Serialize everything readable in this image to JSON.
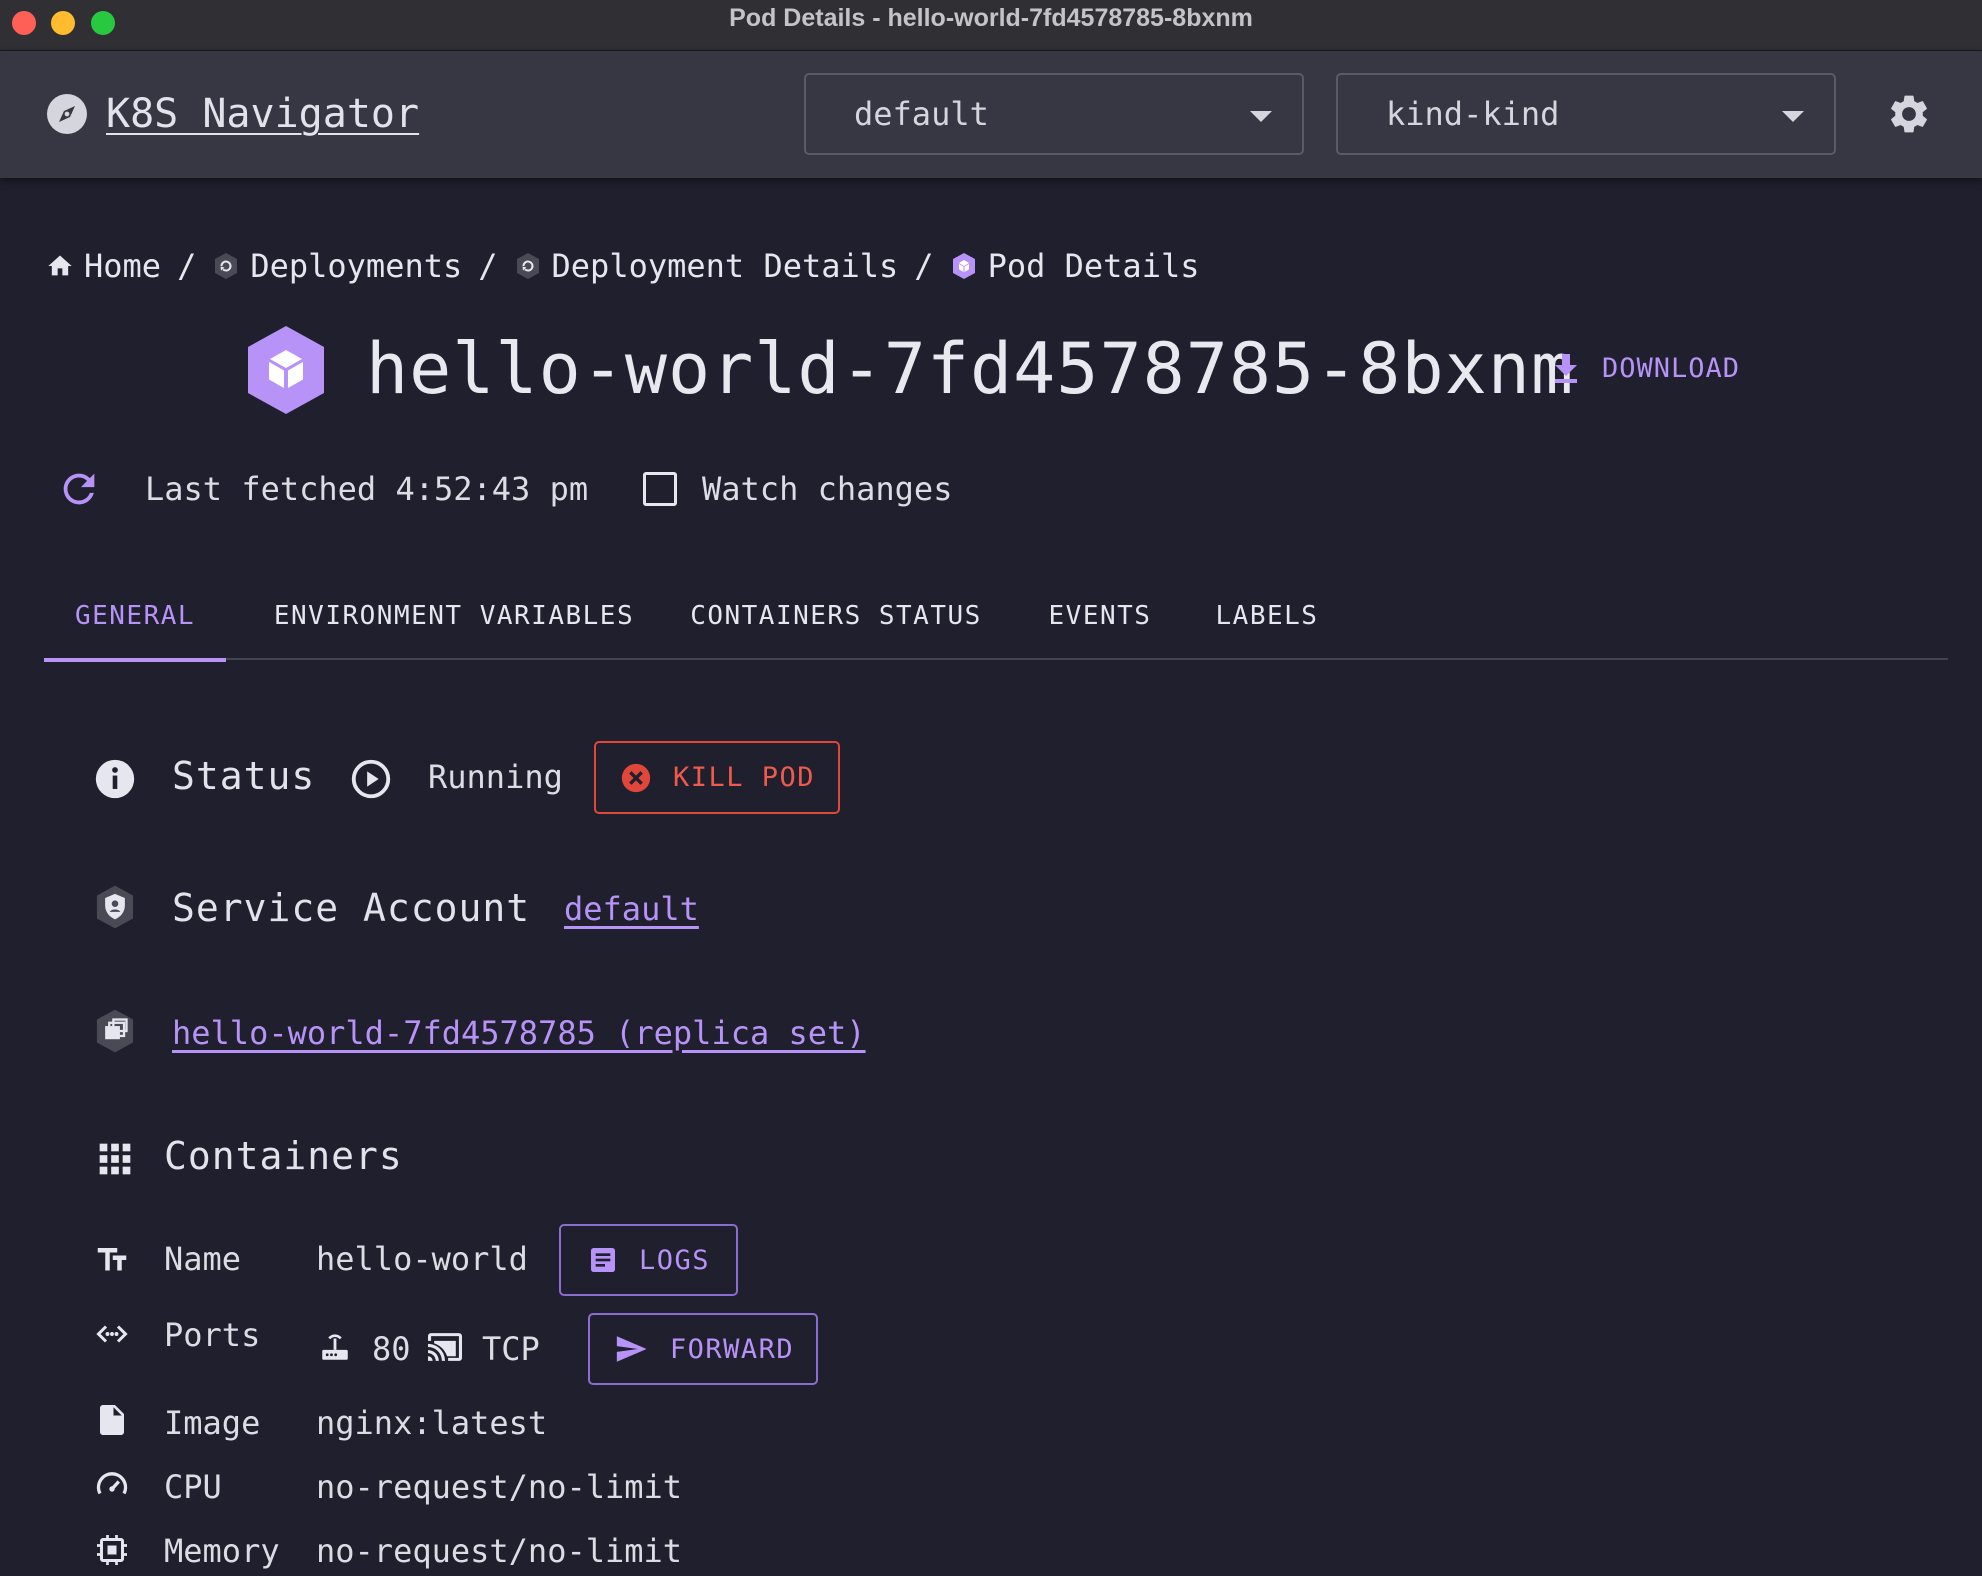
{
  "window": {
    "title": "Pod Details - hello-world-7fd4578785-8bxnm"
  },
  "appbar": {
    "brand": "K8S Navigator",
    "namespace_select": "default",
    "context_select": "kind-kind"
  },
  "breadcrumb": [
    {
      "label": "Home",
      "icon": "home-icon"
    },
    {
      "label": "Deployments",
      "icon": "deployment-icon"
    },
    {
      "label": "Deployment Details",
      "icon": "deployment-icon"
    },
    {
      "label": "Pod Details",
      "icon": "pod-icon"
    }
  ],
  "breadcrumb_separator": "/",
  "page": {
    "title": "hello-world-7fd4578785-8bxnm",
    "download_label": "DOWNLOAD",
    "last_fetched": "Last fetched 4:52:43 pm",
    "watch_label": "Watch changes",
    "watch_checked": false
  },
  "tabs": [
    {
      "label": "GENERAL",
      "active": true
    },
    {
      "label": "ENVIRONMENT VARIABLES",
      "active": false
    },
    {
      "label": "CONTAINERS STATUS",
      "active": false
    },
    {
      "label": "EVENTS",
      "active": false
    },
    {
      "label": "LABELS",
      "active": false
    }
  ],
  "general": {
    "status_label": "Status",
    "status_value": "Running",
    "kill_label": "KILL POD",
    "service_account_label": "Service Account",
    "service_account_value": "default",
    "replica_set_link": "hello-world-7fd4578785 (replica set)"
  },
  "containers": {
    "heading": "Containers",
    "name_label": "Name",
    "name_value": "hello-world",
    "logs_label": "LOGS",
    "ports_label": "Ports",
    "port_number": "80",
    "port_protocol": "TCP",
    "forward_label": "FORWARD",
    "image_label": "Image",
    "image_value": "nginx:latest",
    "cpu_label": "CPU",
    "cpu_value": "no-request/no-limit",
    "memory_label": "Memory",
    "memory_value": "no-request/no-limit"
  },
  "colors": {
    "background": "#1f1f2e",
    "appbar": "#373743",
    "accent": "#b893f7",
    "danger": "#e0463a"
  }
}
